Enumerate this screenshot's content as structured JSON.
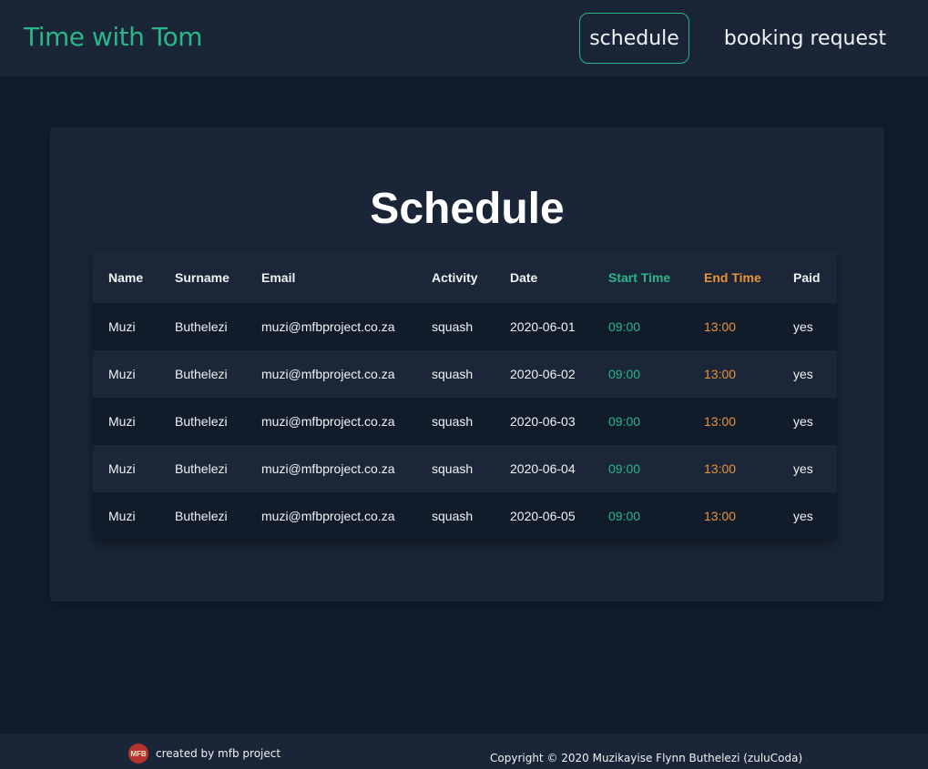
{
  "nav": {
    "brand": "Time with Tom",
    "links": [
      {
        "label": "schedule",
        "active": true
      },
      {
        "label": "booking request",
        "active": false
      }
    ]
  },
  "main": {
    "title": "Schedule",
    "table": {
      "columns": [
        "Name",
        "Surname",
        "Email",
        "Activity",
        "Date",
        "Start Time",
        "End Time",
        "Paid"
      ],
      "rows": [
        [
          "Muzi",
          "Buthelezi",
          "muzi@mfbproject.co.za",
          "squash",
          "2020-06-01",
          "09:00",
          "13:00",
          "yes"
        ],
        [
          "Muzi",
          "Buthelezi",
          "muzi@mfbproject.co.za",
          "squash",
          "2020-06-02",
          "09:00",
          "13:00",
          "yes"
        ],
        [
          "Muzi",
          "Buthelezi",
          "muzi@mfbproject.co.za",
          "squash",
          "2020-06-03",
          "09:00",
          "13:00",
          "yes"
        ],
        [
          "Muzi",
          "Buthelezi",
          "muzi@mfbproject.co.za",
          "squash",
          "2020-06-04",
          "09:00",
          "13:00",
          "yes"
        ],
        [
          "Muzi",
          "Buthelezi",
          "muzi@mfbproject.co.za",
          "squash",
          "2020-06-05",
          "09:00",
          "13:00",
          "yes"
        ]
      ]
    }
  },
  "footer": {
    "logo_text": "MFB",
    "created_by": "created by mfb project",
    "copyright": "Copyright © 2020 Muzikayise Flynn Buthelezi (zuluCoda)"
  },
  "colors": {
    "accent_green": "#2ab689",
    "accent_orange": "#e99238",
    "background": "#111c2b",
    "surface": "#1a2637"
  }
}
